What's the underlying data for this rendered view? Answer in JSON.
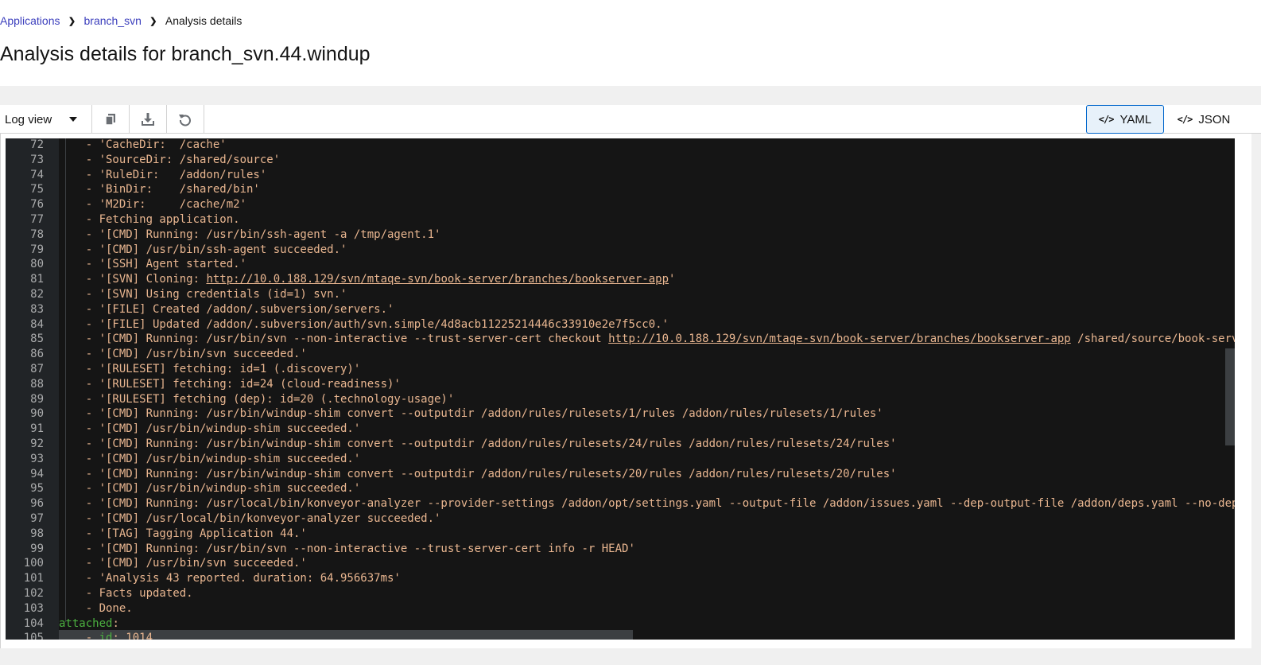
{
  "breadcrumb": {
    "items": [
      {
        "label": "Applications",
        "link": true
      },
      {
        "label": "branch_svn",
        "link": true
      },
      {
        "label": "Analysis details",
        "link": false
      }
    ]
  },
  "page": {
    "title": "Analysis details for branch_svn.44.windup"
  },
  "toolbar": {
    "view_select": "Log view",
    "copy_icon": "copy-icon",
    "download_icon": "download-icon",
    "reload_icon": "undo-icon",
    "toggle_yaml": "YAML",
    "toggle_json": "JSON",
    "code_icon": "</>"
  },
  "editor": {
    "lines": [
      {
        "n": "72",
        "text": "    - 'CacheDir:  /cache'"
      },
      {
        "n": "73",
        "text": "    - 'SourceDir: /shared/source'"
      },
      {
        "n": "74",
        "text": "    - 'RuleDir:   /addon/rules'"
      },
      {
        "n": "75",
        "text": "    - 'BinDir:    /shared/bin'"
      },
      {
        "n": "76",
        "text": "    - 'M2Dir:     /cache/m2'"
      },
      {
        "n": "77",
        "text": "    - Fetching application."
      },
      {
        "n": "78",
        "text": "    - '[CMD] Running: /usr/bin/ssh-agent -a /tmp/agent.1'"
      },
      {
        "n": "79",
        "text": "    - '[CMD] /usr/bin/ssh-agent succeeded.'"
      },
      {
        "n": "80",
        "text": "    - '[SSH] Agent started.'"
      },
      {
        "n": "81",
        "pre": "    - '[SVN] Cloning: ",
        "link": "http://10.0.188.129/svn/mtaqe-svn/book-server/branches/bookserver-app",
        "post": "'"
      },
      {
        "n": "82",
        "text": "    - '[SVN] Using credentials (id=1) svn.'"
      },
      {
        "n": "83",
        "text": "    - '[FILE] Created /addon/.subversion/servers.'"
      },
      {
        "n": "84",
        "text": "    - '[FILE] Updated /addon/.subversion/auth/svn.simple/4d8acb11225214446c33910e2e7f5cc0.'"
      },
      {
        "n": "85",
        "pre": "    - '[CMD] Running: /usr/bin/svn --non-interactive --trust-server-cert checkout ",
        "link": "http://10.0.188.129/svn/mtaqe-svn/book-server/branches/bookserver-app",
        "post": " /shared/source/book-server"
      },
      {
        "n": "86",
        "text": "    - '[CMD] /usr/bin/svn succeeded.'"
      },
      {
        "n": "87",
        "text": "    - '[RULESET] fetching: id=1 (.discovery)'"
      },
      {
        "n": "88",
        "text": "    - '[RULESET] fetching: id=24 (cloud-readiness)'"
      },
      {
        "n": "89",
        "text": "    - '[RULESET] fetching (dep): id=20 (.technology-usage)'"
      },
      {
        "n": "90",
        "text": "    - '[CMD] Running: /usr/bin/windup-shim convert --outputdir /addon/rules/rulesets/1/rules /addon/rules/rulesets/1/rules'"
      },
      {
        "n": "91",
        "text": "    - '[CMD] /usr/bin/windup-shim succeeded.'"
      },
      {
        "n": "92",
        "text": "    - '[CMD] Running: /usr/bin/windup-shim convert --outputdir /addon/rules/rulesets/24/rules /addon/rules/rulesets/24/rules'"
      },
      {
        "n": "93",
        "text": "    - '[CMD] /usr/bin/windup-shim succeeded.'"
      },
      {
        "n": "94",
        "text": "    - '[CMD] Running: /usr/bin/windup-shim convert --outputdir /addon/rules/rulesets/20/rules /addon/rules/rulesets/20/rules'"
      },
      {
        "n": "95",
        "text": "    - '[CMD] /usr/bin/windup-shim succeeded.'"
      },
      {
        "n": "96",
        "text": "    - '[CMD] Running: /usr/local/bin/konveyor-analyzer --provider-settings /addon/opt/settings.yaml --output-file /addon/issues.yaml --dep-output-file /addon/deps.yaml --no-depen"
      },
      {
        "n": "97",
        "text": "    - '[CMD] /usr/local/bin/konveyor-analyzer succeeded.'"
      },
      {
        "n": "98",
        "text": "    - '[TAG] Tagging Application 44.'"
      },
      {
        "n": "99",
        "text": "    - '[CMD] Running: /usr/bin/svn --non-interactive --trust-server-cert info -r HEAD'"
      },
      {
        "n": "100",
        "text": "    - '[CMD] /usr/bin/svn succeeded.'"
      },
      {
        "n": "101",
        "text": "    - 'Analysis 43 reported. duration: 64.956637ms'"
      },
      {
        "n": "102",
        "text": "    - Facts updated."
      },
      {
        "n": "103",
        "text": "    - Done."
      },
      {
        "n": "104",
        "key": "attached",
        "post": ":"
      },
      {
        "n": "105",
        "pre": "    - ",
        "key": "id",
        "post": ": 1014"
      }
    ]
  }
}
